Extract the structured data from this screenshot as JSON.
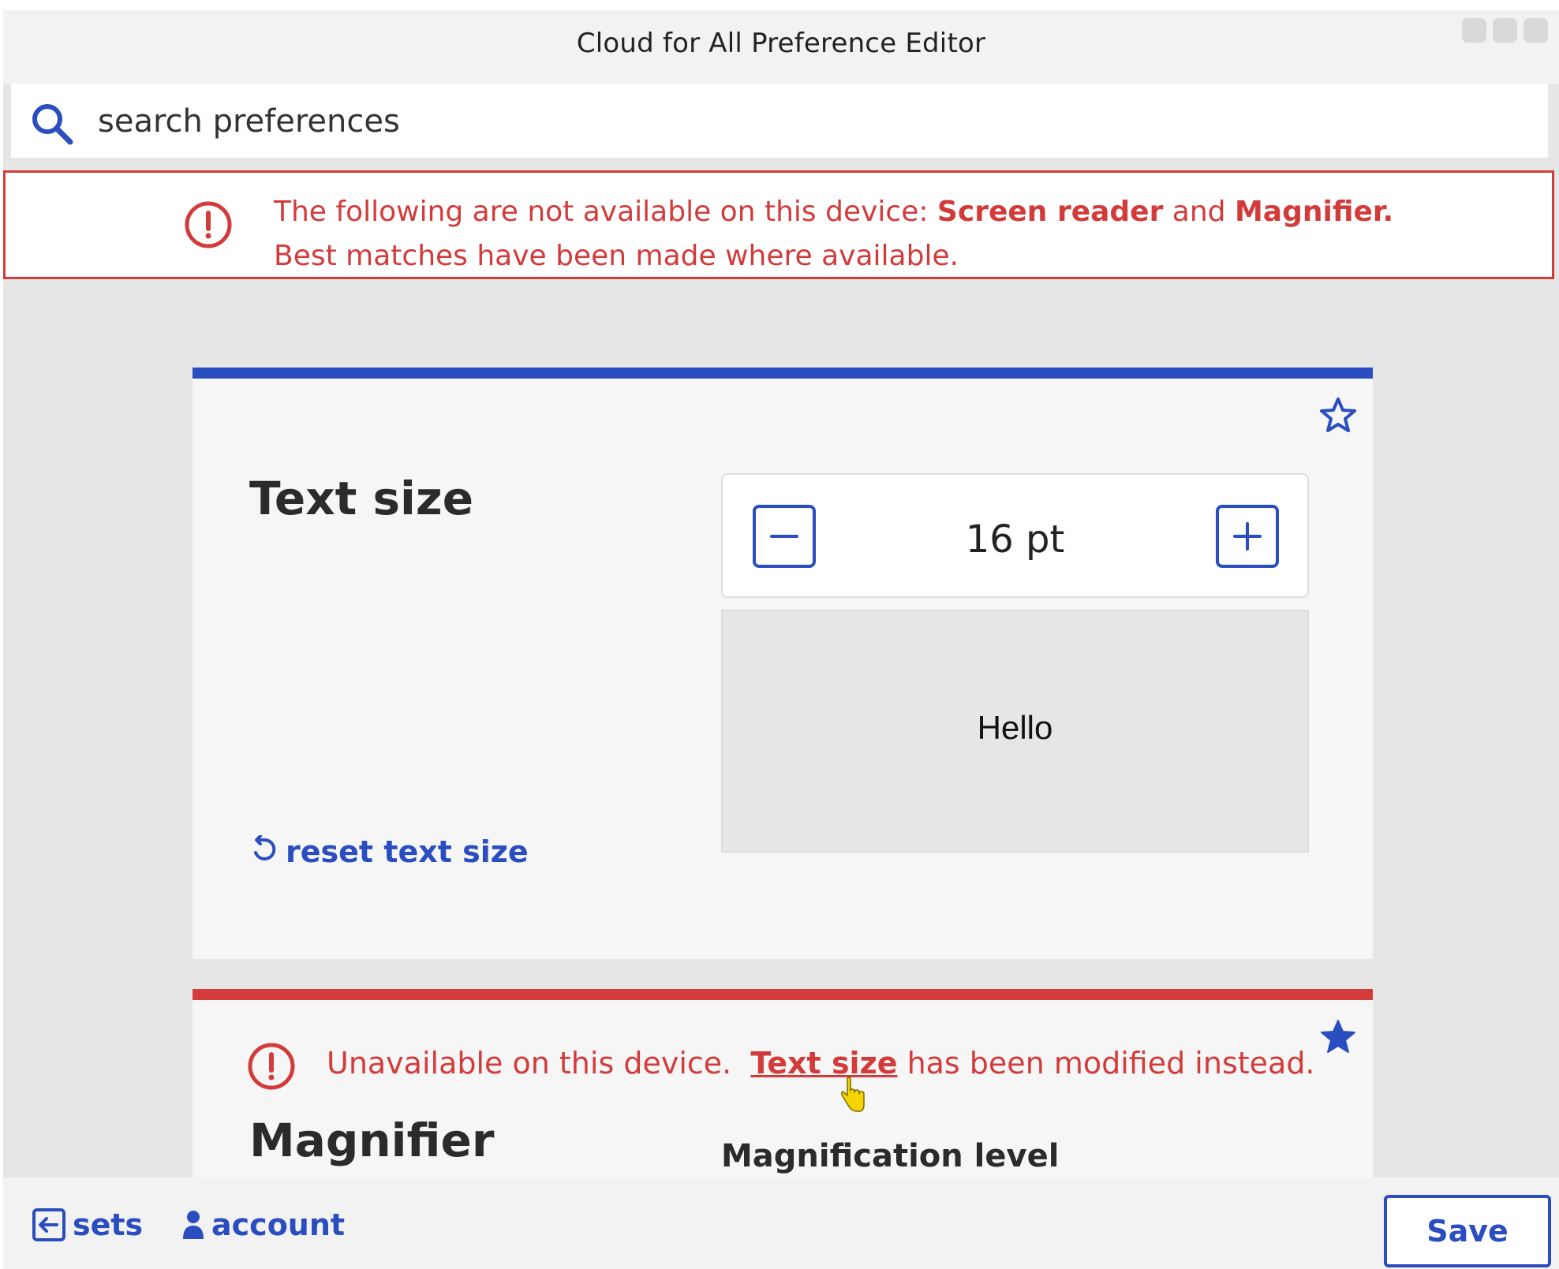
{
  "window": {
    "title": "Cloud for All Preference Editor"
  },
  "search": {
    "placeholder": "search preferences"
  },
  "alert": {
    "line1_prefix": "The following are not available on this device: ",
    "item1": "Screen reader",
    "joiner": " and ",
    "item2": "Magnifier.",
    "line2": "Best matches have been made where available."
  },
  "text_size_card": {
    "heading": "Text size",
    "value": "16 pt",
    "preview_text": "Hello",
    "reset_label": "reset text size",
    "favorited": false
  },
  "magnifier_card": {
    "unavailable_prefix": "Unavailable on this device.  ",
    "modified_link": "Text size",
    "unavailable_suffix": " has been modified instead.",
    "heading": "Magnifier",
    "level_label": "Magnification level",
    "favorited": true
  },
  "bottom": {
    "sets_label": "sets",
    "account_label": "account",
    "save_label": "Save"
  },
  "colors": {
    "accent": "#2a4dbf",
    "error": "#d33b3b"
  },
  "icons": [
    "search-icon",
    "alert-icon",
    "star-outline-icon",
    "star-filled-icon",
    "minus-icon",
    "plus-icon",
    "reset-icon",
    "hand-cursor-icon",
    "exit-icon",
    "user-icon"
  ]
}
